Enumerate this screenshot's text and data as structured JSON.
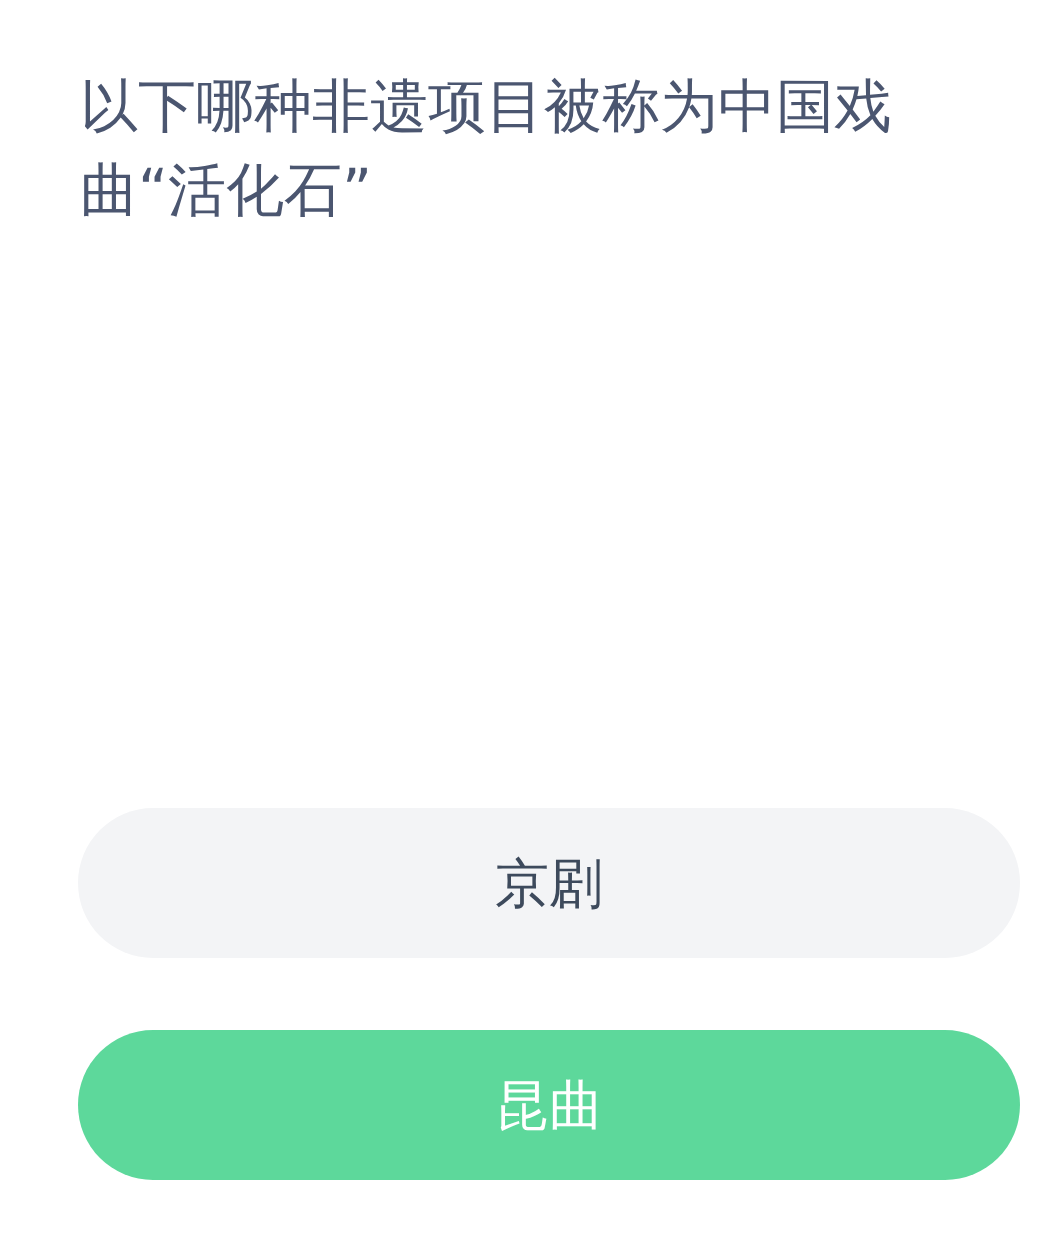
{
  "question": "以下哪种非遗项目被称为中国戏曲“活化石”",
  "options": [
    {
      "label": "京剧",
      "selected": false
    },
    {
      "label": "昆曲",
      "selected": true
    }
  ]
}
